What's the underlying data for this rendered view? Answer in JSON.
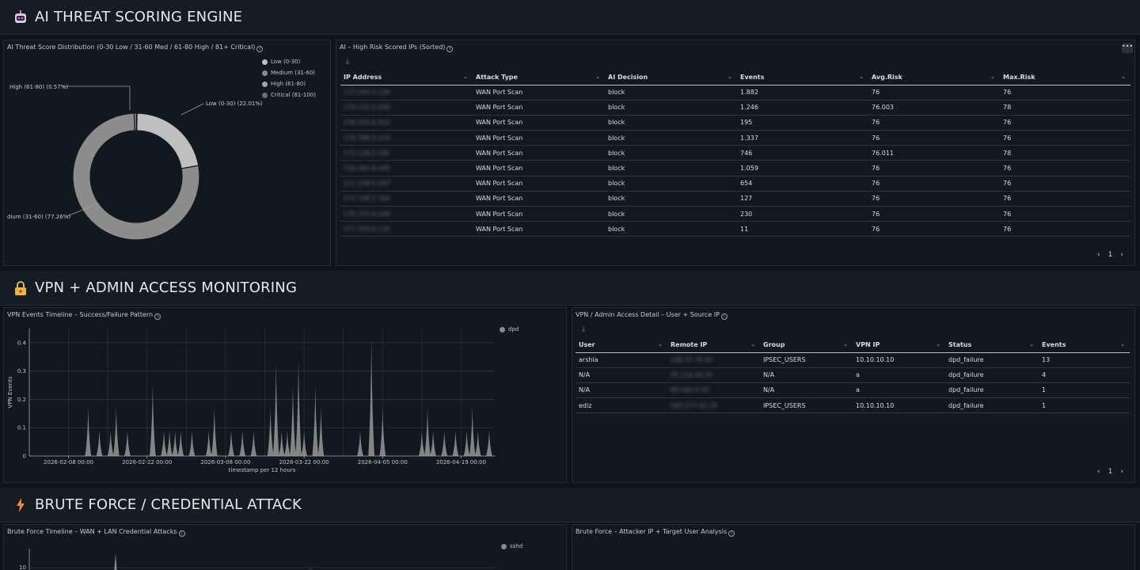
{
  "sections": {
    "ai": {
      "icon": "robot-icon",
      "title": "AI THREAT SCORING ENGINE"
    },
    "vpn": {
      "icon": "lock-icon",
      "title": "VPN + ADMIN ACCESS MONITORING"
    },
    "brute": {
      "icon": "lightning-icon",
      "title": "BRUTE FORCE / CREDENTIAL ATTACK"
    }
  },
  "panels": {
    "ai_dist": {
      "title": "AI Threat Score Distribution (0-30 Low / 31-60 Med / 61-80 High / 81+ Critical)",
      "legend": [
        {
          "label": "Low (0-30)",
          "color": "#bfbfbf"
        },
        {
          "label": "Medium (31-60)",
          "color": "#8c8c8c"
        },
        {
          "label": "High (61-80)",
          "color": "#a6a6a6"
        },
        {
          "label": "Critical (81-100)",
          "color": "#6e6e6e"
        }
      ],
      "slice_labels": {
        "high": "High (61-80) (0.57%)",
        "low": "Low (0-30) (22.01%)",
        "medium": "dium (31-60) (77.26%)"
      }
    },
    "high_risk": {
      "title": "AI – High Risk Scored IPs (Sorted)",
      "columns": [
        "IP Address",
        "Attack Type",
        "AI Decision",
        "Events",
        "Avg.Risk",
        "Max.Risk"
      ],
      "rows": [
        [
          "177.143.5.134",
          "WAN Port Scan",
          "block",
          "1.882",
          "76",
          "76"
        ],
        [
          "170.132.5.109",
          "WAN Port Scan",
          "block",
          "1.246",
          "76.003",
          "78"
        ],
        [
          "176.155.6.152",
          "WAN Port Scan",
          "block",
          "195",
          "76",
          "76"
        ],
        [
          "179.188.5.143",
          "WAN Port Scan",
          "block",
          "1.337",
          "76",
          "76"
        ],
        [
          "172.130.5.145",
          "WAN Port Scan",
          "block",
          "746",
          "76.011",
          "78"
        ],
        [
          "110.162.6.145",
          "WAN Port Scan",
          "block",
          "1.059",
          "76",
          "76"
        ],
        [
          "111.158.5.167",
          "WAN Port Scan",
          "block",
          "654",
          "76",
          "76"
        ],
        [
          "172.158.2.164",
          "WAN Port Scan",
          "block",
          "127",
          "76",
          "76"
        ],
        [
          "170.155.6.149",
          "WAN Port Scan",
          "block",
          "230",
          "76",
          "76"
        ],
        [
          "177.155.6.133",
          "WAN Port Scan",
          "block",
          "11",
          "76",
          "76"
        ]
      ],
      "page": "1"
    },
    "vpn_timeline": {
      "title": "VPN Events Timeline – Success/Failure Pattern",
      "legend": "dpd"
    },
    "vpn_detail": {
      "title": "VPN / Admin Access Detail – User + Source IP",
      "columns": [
        "User",
        "Remote IP",
        "Group",
        "VPN IP",
        "Status",
        "Events"
      ],
      "rows": [
        [
          "arshia",
          "100.57.76.42",
          "IPSEC_USERS",
          "10.10.10.10",
          "dpd_failure",
          "13"
        ],
        [
          "N/A",
          "95.116.44.55",
          "N/A",
          "a",
          "dpd_failure",
          "4"
        ],
        [
          "N/A",
          "90.162.4.55",
          "N/A",
          "a",
          "dpd_failure",
          "1"
        ],
        [
          "ediz",
          "165.177.41.76",
          "IPSEC_USERS",
          "10.10.10.10",
          "dpd_failure",
          "1"
        ]
      ],
      "page": "1"
    },
    "brute_timeline": {
      "title": "Brute Force Timeline – WAN + LAN Credential Attacks",
      "legend": "sshd"
    },
    "brute_detail": {
      "title": "Brute Force – Attacker IP + Target User Analysis"
    }
  },
  "chart_data": [
    {
      "type": "pie",
      "title": "AI Threat Score Distribution (0-30 Low / 31-60 Med / 61-80 High / 81+ Critical)",
      "labels": [
        "Low (0-30)",
        "Medium (31-60)",
        "High (61-80)",
        "Critical (81-100)"
      ],
      "values": [
        22.01,
        77.26,
        0.57,
        0.16
      ],
      "colors": [
        "#bfbfbf",
        "#8c8c8c",
        "#a6a6a6",
        "#6e6e6e"
      ],
      "donut": true
    },
    {
      "type": "area",
      "title": "VPN Events Timeline – Success/Failure Pattern",
      "xlabel": "timestamp per 12 hours",
      "ylabel": "VPN Events",
      "ylim": [
        0,
        0.45
      ],
      "yticks": [
        "0",
        "0.1",
        "0.2",
        "0.3",
        "0.4"
      ],
      "xticks": [
        "2026-02-08 00:00",
        "2026-02-22 00:00",
        "2026-03-08 00:00",
        "2026-03-22 00:00",
        "2026-04-05 00:00",
        "2026-04-19 00:00"
      ],
      "series": [
        {
          "name": "dpd",
          "x_start": "2026-02-01 00:00",
          "x_step_hours": 12,
          "spikes": [
            {
              "i": 21,
              "v": 0.17
            },
            {
              "i": 25,
              "v": 0.09
            },
            {
              "i": 29,
              "v": 0.09
            },
            {
              "i": 31,
              "v": 0.17
            },
            {
              "i": 35,
              "v": 0.09
            },
            {
              "i": 44,
              "v": 0.25
            },
            {
              "i": 48,
              "v": 0.09
            },
            {
              "i": 50,
              "v": 0.09
            },
            {
              "i": 52,
              "v": 0.09
            },
            {
              "i": 54,
              "v": 0.09
            },
            {
              "i": 58,
              "v": 0.09
            },
            {
              "i": 64,
              "v": 0.09
            },
            {
              "i": 66,
              "v": 0.17
            },
            {
              "i": 72,
              "v": 0.09
            },
            {
              "i": 76,
              "v": 0.09
            },
            {
              "i": 80,
              "v": 0.09
            },
            {
              "i": 86,
              "v": 0.17
            },
            {
              "i": 88,
              "v": 0.33
            },
            {
              "i": 90,
              "v": 0.09
            },
            {
              "i": 92,
              "v": 0.09
            },
            {
              "i": 94,
              "v": 0.25
            },
            {
              "i": 96,
              "v": 0.34
            },
            {
              "i": 98,
              "v": 0.09
            },
            {
              "i": 102,
              "v": 0.25
            },
            {
              "i": 104,
              "v": 0.17
            },
            {
              "i": 118,
              "v": 0.09
            },
            {
              "i": 122,
              "v": 0.42
            },
            {
              "i": 126,
              "v": 0.17
            },
            {
              "i": 140,
              "v": 0.09
            },
            {
              "i": 142,
              "v": 0.17
            },
            {
              "i": 144,
              "v": 0.09
            },
            {
              "i": 148,
              "v": 0.09
            },
            {
              "i": 152,
              "v": 0.09
            },
            {
              "i": 156,
              "v": 0.09
            },
            {
              "i": 158,
              "v": 0.17
            },
            {
              "i": 160,
              "v": 0.09
            },
            {
              "i": 164,
              "v": 0.09
            }
          ],
          "color": "#8a8a8a"
        }
      ]
    },
    {
      "type": "area",
      "title": "Brute Force Timeline – WAN + LAN Credential Attacks",
      "yticks": [
        "10"
      ],
      "series": [
        {
          "name": "sshd",
          "color": "#8a8a8a"
        }
      ]
    }
  ]
}
